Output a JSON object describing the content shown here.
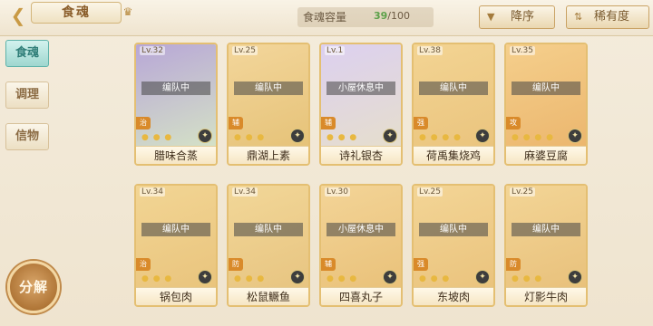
{
  "header": {
    "title": "食魂",
    "capacity_label": "食魂容量",
    "capacity_current": "39",
    "capacity_max": "/100",
    "sort_label": "降序",
    "rarity_label": "稀有度"
  },
  "icons": {
    "back": "back-arrow-icon",
    "crown": "crown-icon",
    "sort": "sort-icon",
    "rarity": "filter-icon",
    "rank": "rank-badge-icon"
  },
  "sidebar": {
    "items": [
      {
        "label": "食魂",
        "active": true
      },
      {
        "label": "调理",
        "active": false
      },
      {
        "label": "信物",
        "active": false
      }
    ],
    "decompose_label": "分解"
  },
  "cards": [
    {
      "level": "Lv.32",
      "status": "编队中",
      "role": "治",
      "name": "腊味合蒸",
      "stars": "● ● ●",
      "colors": [
        "#b8a7d7",
        "#d8e9c4"
      ]
    },
    {
      "level": "Lv.25",
      "status": "编队中",
      "role": "辅",
      "name": "鼎湖上素",
      "stars": "● ● ●",
      "colors": [
        "#f3d69b",
        "#e4c074"
      ]
    },
    {
      "level": "Lv.1",
      "status": "小屋休息中",
      "role": "辅",
      "name": "诗礼银杏",
      "stars": "● ● ●",
      "colors": [
        "#dcd0f0",
        "#e7e0c8"
      ]
    },
    {
      "level": "Lv.38",
      "status": "编队中",
      "role": "强",
      "name": "荷禹集烧鸡",
      "stars": "● ● ● ●",
      "colors": [
        "#f3d493",
        "#e9c27b"
      ]
    },
    {
      "level": "Lv.35",
      "status": "编队中",
      "role": "攻",
      "name": "麻婆豆腐",
      "stars": "● ● ● ●",
      "colors": [
        "#f5cf8c",
        "#eab36a"
      ]
    },
    {
      "level": "Lv.34",
      "status": "编队中",
      "role": "治",
      "name": "锅包肉",
      "stars": "● ● ●",
      "colors": [
        "#f2d594",
        "#e8c27a"
      ]
    },
    {
      "level": "Lv.34",
      "status": "编队中",
      "role": "防",
      "name": "松鼠鳜鱼",
      "stars": "● ● ●",
      "colors": [
        "#f2d798",
        "#e6c27e"
      ]
    },
    {
      "level": "Lv.30",
      "status": "小屋休息中",
      "role": "辅",
      "name": "四喜丸子",
      "stars": "● ● ●",
      "colors": [
        "#f3d497",
        "#e8bf76"
      ]
    },
    {
      "level": "Lv.25",
      "status": "编队中",
      "role": "强",
      "name": "东坡肉",
      "stars": "● ● ●",
      "colors": [
        "#f3d596",
        "#e9c17a"
      ]
    },
    {
      "level": "Lv.25",
      "status": "编队中",
      "role": "防",
      "name": "灯影牛肉",
      "stars": "● ● ●",
      "colors": [
        "#f3d596",
        "#e7be78"
      ]
    }
  ]
}
